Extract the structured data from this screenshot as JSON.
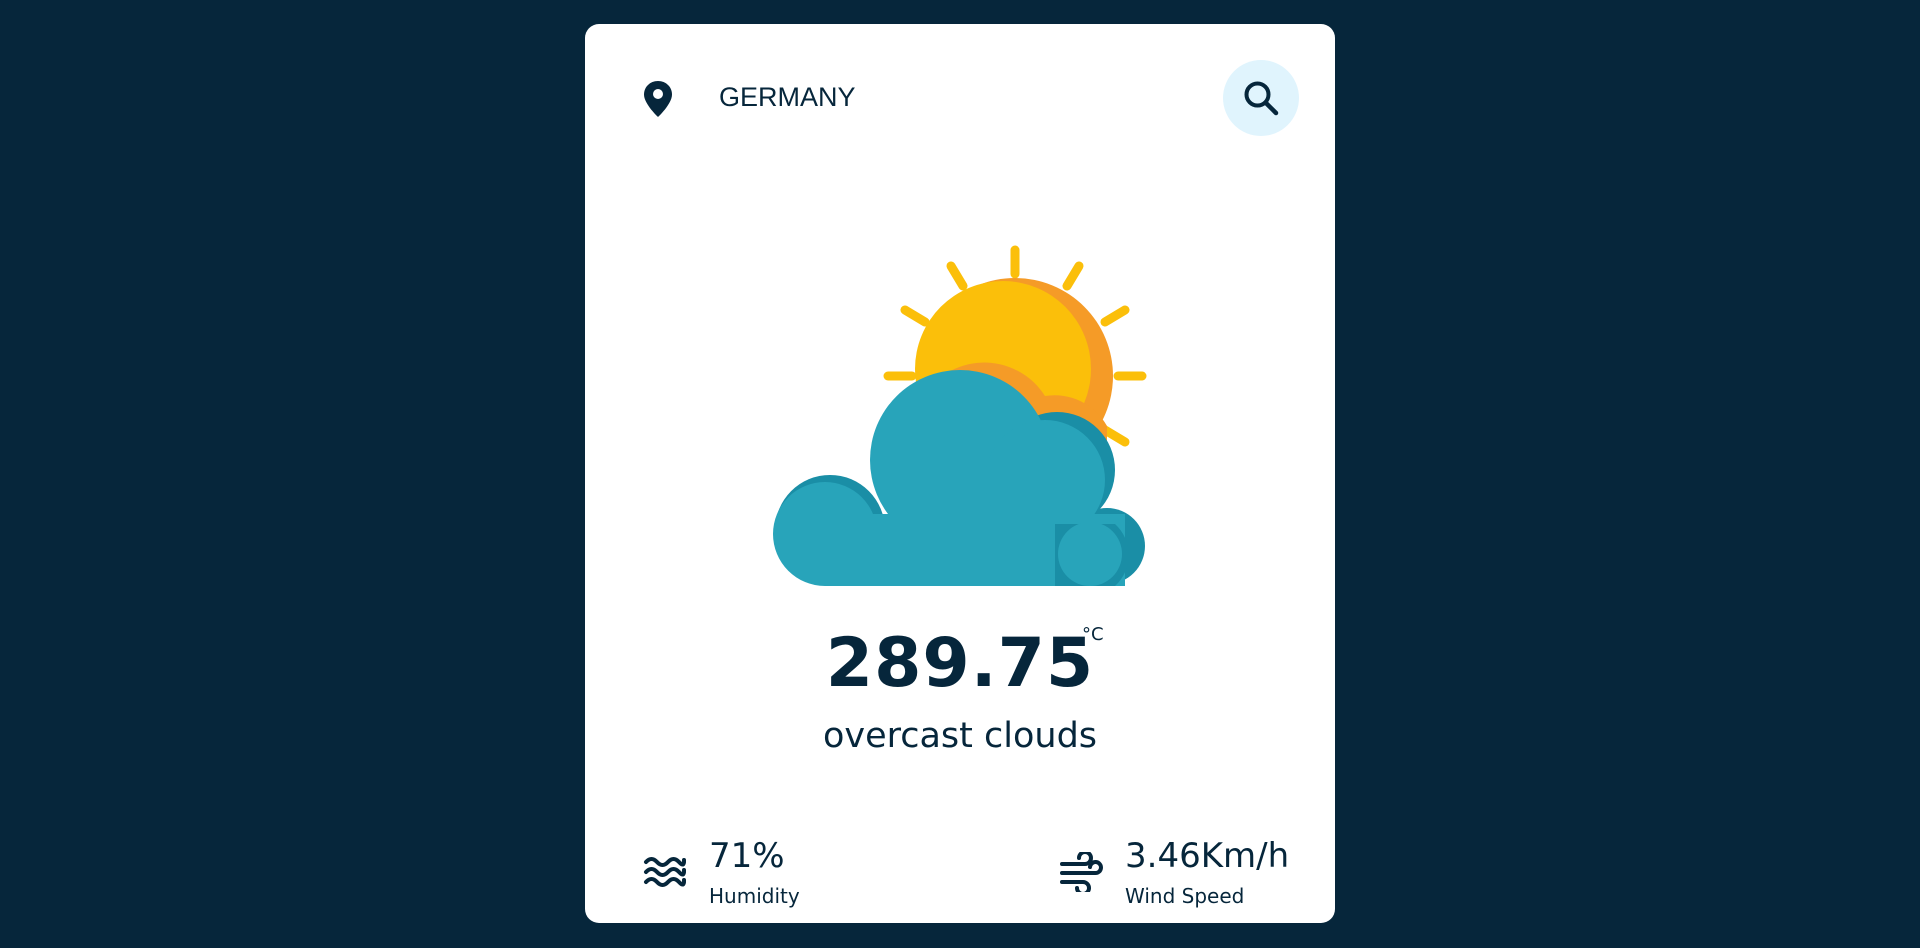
{
  "search": {
    "value": "GERMANY",
    "location_icon": "map-pin-icon",
    "button_icon": "search-icon"
  },
  "weather": {
    "illustration_icon": "sun-behind-cloud-icon",
    "temperature": "289.75",
    "unit": "°C",
    "description": "overcast clouds"
  },
  "details": {
    "humidity": {
      "icon": "water-waves-icon",
      "value": "71%",
      "label": "Humidity"
    },
    "wind": {
      "icon": "wind-icon",
      "value": "3.46Km/h",
      "label": "Wind Speed"
    }
  },
  "colors": {
    "background": "#06263b",
    "card": "#ffffff",
    "search_button_bg": "#e0f4fd",
    "sun": "#fbbf0a",
    "sun_shade": "#f59b27",
    "cloud": "#28a4ba",
    "cloud_shade": "#1a8ea6"
  }
}
